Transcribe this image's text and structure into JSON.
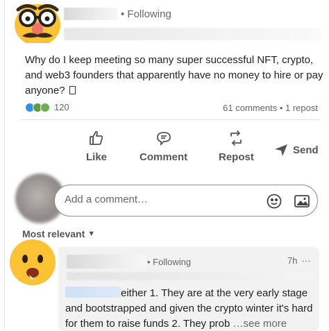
{
  "post": {
    "follow_status": "• Following",
    "text": "Why do I keep meeting so many super successful NFT, crypto, and web3 founders that apparently have no money to hire or pay anyone?",
    "reaction_count": "120",
    "comments_count": "61 comments",
    "reposts_count": "1 repost",
    "stats_separator": "•"
  },
  "actions": {
    "like": "Like",
    "comment": "Comment",
    "repost": "Repost",
    "send": "Send"
  },
  "comment_box": {
    "placeholder": "Add a comment…"
  },
  "sort": {
    "label": "Most relevant"
  },
  "comment": {
    "follow_status": "• Following",
    "time": "7h",
    "menu": "···",
    "text": "either 1. They are at the very early stage and bootstrapped and given the crypto winter it's hard for them to raise funds 2. They prob",
    "see_more": "…see more"
  },
  "colors": {
    "accent": "#0a66c2",
    "muted": "#666666"
  }
}
